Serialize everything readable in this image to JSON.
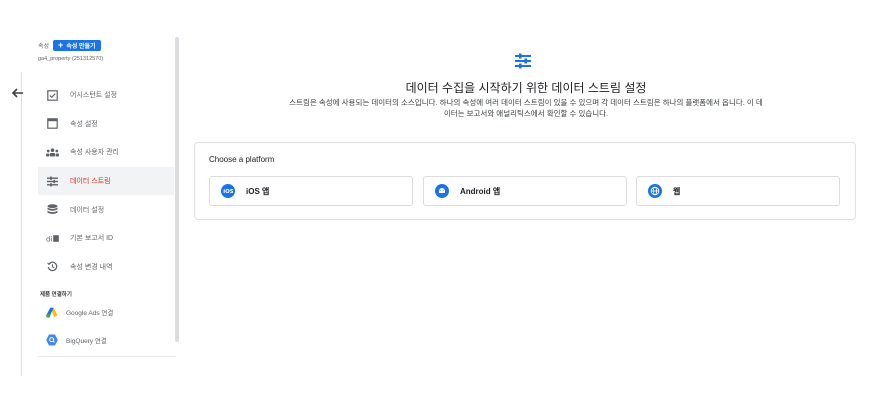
{
  "sidebar": {
    "property_label": "속성",
    "create_button": "속성 만들기",
    "property_id": "ga4_property (251312570)",
    "items": [
      {
        "label": "어시스턴트 설정",
        "icon": "checkbox-icon"
      },
      {
        "label": "속성 설정",
        "icon": "calendar-icon"
      },
      {
        "label": "속성 사용자 관리",
        "icon": "people-icon"
      },
      {
        "label": "데이터 스트림",
        "icon": "data-stream-icon",
        "active": true
      },
      {
        "label": "데이터 설정",
        "icon": "database-icon"
      },
      {
        "label": "기본 보고서 ID",
        "icon": "report-id-icon"
      },
      {
        "label": "속성 변경 내역",
        "icon": "history-icon"
      }
    ],
    "section_label": "제품 연결하기",
    "links": [
      {
        "label": "Google Ads 연결",
        "icon": "google-ads-icon"
      },
      {
        "label": "BigQuery 연결",
        "icon": "bigquery-icon"
      }
    ]
  },
  "main": {
    "title": "데이터 수집을 시작하기 위한 데이터 스트림 설정",
    "description_line1": "스트림은 속성에 사용되는 데이터의 소스입니다. 하나의 속성에 여러 데이터 스트림이 있을 수 있으며 각 데이터 스트림은 하나의 플랫폼에서 옵니다. 이 데",
    "description_line2": "이터는 보고서와 애널리틱스에서 확인할 수 있습니다.",
    "platform_card": {
      "title": "Choose a platform",
      "options": [
        {
          "label": "iOS 앱",
          "icon": "ios-icon"
        },
        {
          "label": "Android 앱",
          "icon": "android-icon"
        },
        {
          "label": "웹",
          "icon": "web-globe-icon"
        }
      ]
    }
  },
  "colors": {
    "accent": "#1a73e8",
    "active_red": "#d93025",
    "text_gray": "#5f6368"
  }
}
